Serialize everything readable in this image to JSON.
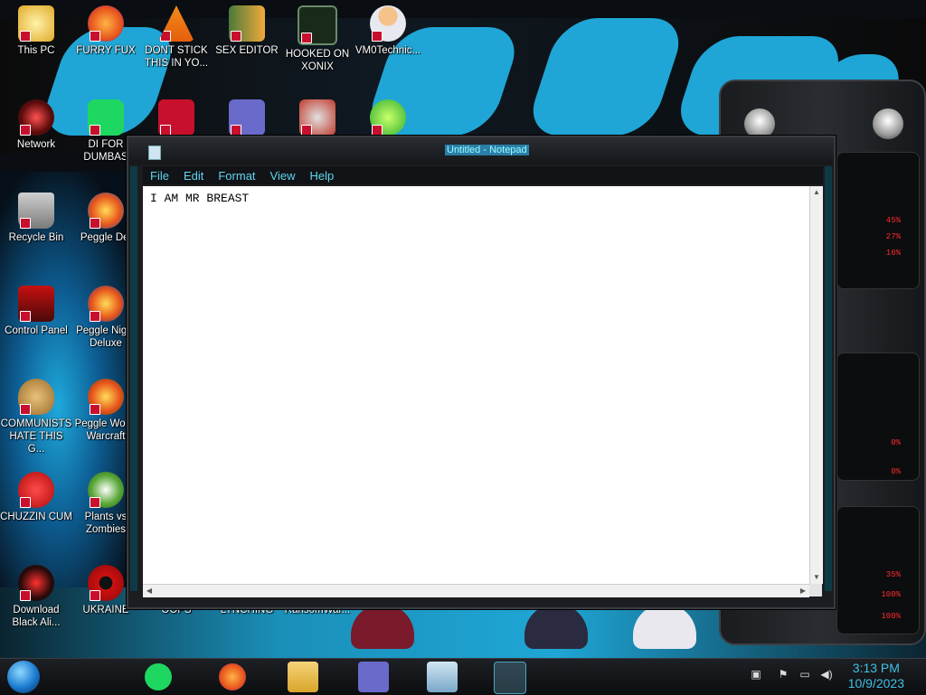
{
  "desktop": {
    "icons": [
      {
        "label": "This PC"
      },
      {
        "label": "FURRY FUX"
      },
      {
        "label": "DONT STICK THIS IN YO..."
      },
      {
        "label": "SEX EDITOR"
      },
      {
        "label": "HOOKED ON XONIX"
      },
      {
        "label": "VM0Technic..."
      },
      {
        "label": "Network"
      },
      {
        "label": "DI FOR DUMBAS"
      },
      {
        "label": "Recycle Bin"
      },
      {
        "label": "Peggle Del"
      },
      {
        "label": "Control Panel"
      },
      {
        "label": "Peggle Night Deluxe"
      },
      {
        "label": "COMMUNISTS HATE THIS G..."
      },
      {
        "label": "Peggle Wo of Warcraft"
      },
      {
        "label": "CHUZZIN CUM"
      },
      {
        "label": "Plants vs Zombies"
      },
      {
        "label": "Download Black Ali..."
      },
      {
        "label": "UKRAINE"
      },
      {
        "label": "OOPS"
      },
      {
        "label": "LYNCHING"
      },
      {
        "label": "RansomWar..."
      }
    ]
  },
  "notepad": {
    "title": "Untitled - Notepad",
    "menus": [
      "File",
      "Edit",
      "Format",
      "View",
      "Help"
    ],
    "content": "I AM MR BREAST"
  },
  "gadget": {
    "values": [
      "45%",
      "27%",
      "16%",
      "0%",
      "0%",
      "35%",
      "100%",
      "100%"
    ],
    "accent": "#ff2a2a"
  },
  "taskbar": {
    "time": "3:13 PM",
    "date": "10/9/2023"
  },
  "colors": {
    "brand_blue": "#1fa6d6",
    "menu_text": "#5fd6f0",
    "clock_text": "#3fc1e6"
  }
}
